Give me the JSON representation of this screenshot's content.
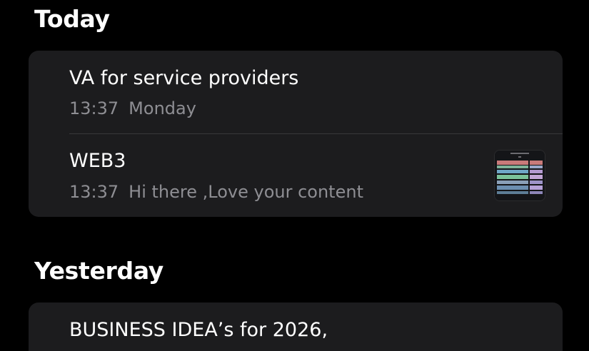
{
  "sections": [
    {
      "title": "Today",
      "notes": [
        {
          "title": "VA for service providers",
          "time": "13:37",
          "preview": "Monday"
        },
        {
          "title": "WEB3",
          "time": "13:37",
          "preview": "Hi there ,Love your content",
          "thumbnail_icon": "spreadsheet-thumbnail"
        }
      ]
    },
    {
      "title": "Yesterday",
      "notes": [
        {
          "title": "BUSINESS IDEA’s for 2026,"
        }
      ]
    }
  ],
  "colors": {
    "background": "#000000",
    "card": "#1c1c1e",
    "secondary_text": "#8e8e93",
    "divider": "#38383a"
  }
}
